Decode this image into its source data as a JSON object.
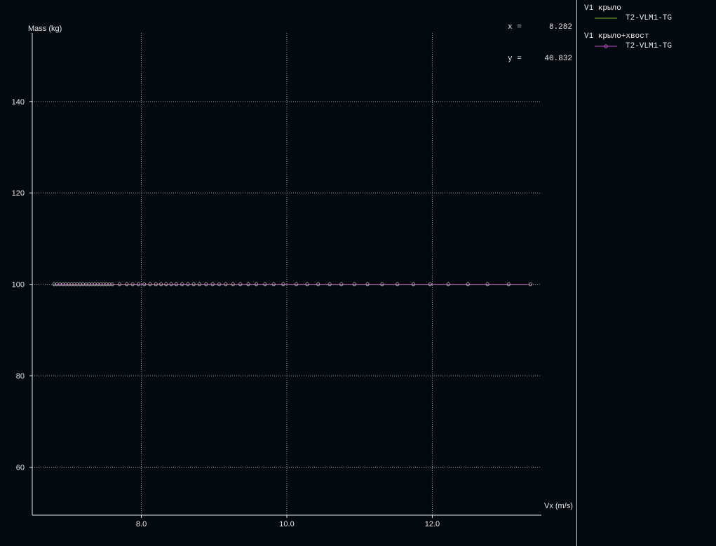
{
  "readout": {
    "x_label": "x =",
    "x_value": "8.282",
    "y_label": "y =",
    "y_value": "40.832"
  },
  "legend": [
    {
      "title": "V1 крыло",
      "entry": "T2-VLM1-TG",
      "color": "#7fc241",
      "marker": "none"
    },
    {
      "title": "V1 крыло+хвост",
      "entry": "T2-VLM1-TG",
      "color": "#c44cc4",
      "marker": "circle"
    }
  ],
  "chart_data": {
    "type": "line",
    "xlabel": "Vx (m/s)",
    "ylabel": "Mass (kg)",
    "xlim": [
      6.5,
      13.5
    ],
    "ylim": [
      49.5,
      155
    ],
    "xticks": [
      8.0,
      10.0,
      12.0
    ],
    "xtick_labels": [
      "8.0",
      "10.0",
      "12.0"
    ],
    "yticks": [
      60,
      80,
      100,
      120,
      140
    ],
    "ytick_labels": [
      "60",
      "80",
      "100",
      "120",
      "140"
    ],
    "grid": true,
    "legend_position": "right panel",
    "colors": {
      "background": "#030a0f",
      "axis": "#e8e8e8",
      "grid": "#9aa4a4",
      "marker": "#a8a8a8"
    },
    "series": [
      {
        "name": "T2-VLM1-TG",
        "color": "#7fc241",
        "marker": "none",
        "x": [
          6.8,
          13.3
        ],
        "y": [
          100,
          100
        ]
      },
      {
        "name": "T2-VLM1-TG",
        "color": "#c44cc4",
        "marker": "circle",
        "x": [
          6.8,
          6.84,
          6.88,
          6.92,
          6.96,
          7.0,
          7.04,
          7.08,
          7.12,
          7.16,
          7.2,
          7.24,
          7.28,
          7.32,
          7.36,
          7.4,
          7.44,
          7.48,
          7.52,
          7.56,
          7.6,
          7.7,
          7.8,
          7.88,
          7.96,
          8.04,
          8.12,
          8.2,
          8.27,
          8.34,
          8.41,
          8.48,
          8.56,
          8.64,
          8.72,
          8.8,
          8.89,
          8.98,
          9.07,
          9.16,
          9.26,
          9.36,
          9.47,
          9.58,
          9.7,
          9.82,
          9.95,
          10.13,
          10.28,
          10.43,
          10.59,
          10.75,
          10.93,
          11.11,
          11.31,
          11.52,
          11.74,
          11.97,
          12.22,
          12.49,
          12.76,
          13.05,
          13.35
        ],
        "y": [
          100,
          100,
          100,
          100,
          100,
          100,
          100,
          100,
          100,
          100,
          100,
          100,
          100,
          100,
          100,
          100,
          100,
          100,
          100,
          100,
          100,
          100,
          100,
          100,
          100,
          100,
          100,
          100,
          100,
          100,
          100,
          100,
          100,
          100,
          100,
          100,
          100,
          100,
          100,
          100,
          100,
          100,
          100,
          100,
          100,
          100,
          100,
          100,
          100,
          100,
          100,
          100,
          100,
          100,
          100,
          100,
          100,
          100,
          100,
          100,
          100,
          100,
          100
        ]
      }
    ]
  }
}
